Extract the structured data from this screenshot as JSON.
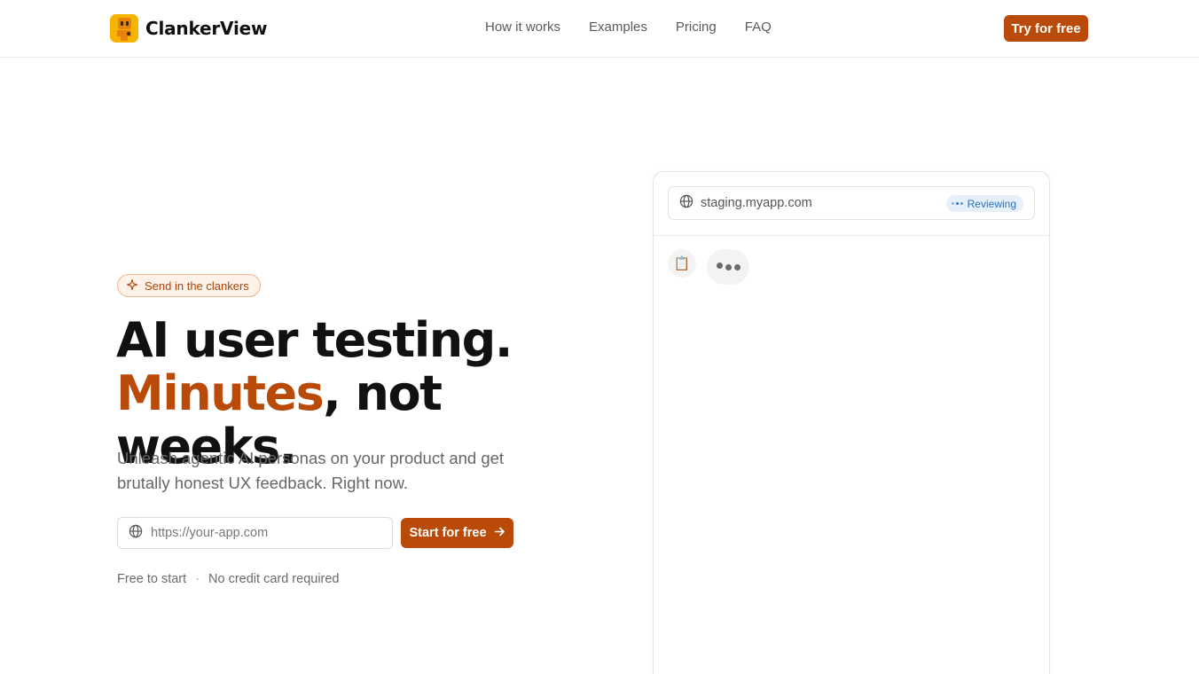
{
  "brand": {
    "name": "ClankerView"
  },
  "nav": {
    "items": [
      {
        "label": "How it works"
      },
      {
        "label": "Examples"
      },
      {
        "label": "Pricing"
      },
      {
        "label": "FAQ"
      }
    ],
    "cta_label": "Try for free"
  },
  "hero": {
    "badge_label": "Send in the clankers",
    "headline_line1": "AI user testing.",
    "headline_accent": "Minutes",
    "headline_rest": ", not weeks.",
    "subhead": "Unleash agentic AI personas on your product and get brutally honest UX feedback. Right now.",
    "url_placeholder": "https://your-app.com",
    "start_label": "Start for free",
    "fineprint_left": "Free to start",
    "fineprint_sep": "·",
    "fineprint_right": "No credit card required"
  },
  "preview": {
    "address": "staging.myapp.com",
    "status": "Reviewing",
    "avatar_emoji": "📋"
  },
  "colors": {
    "accent": "#b94a08",
    "logo_bg": "#f4b400",
    "status_bg": "#e6f0fb",
    "status_text": "#2f6fb8"
  },
  "icons": [
    "robot-logo-icon",
    "sparkle-icon",
    "globe-icon",
    "arrow-right-icon",
    "clipboard-icon",
    "typing-dots-icon"
  ]
}
